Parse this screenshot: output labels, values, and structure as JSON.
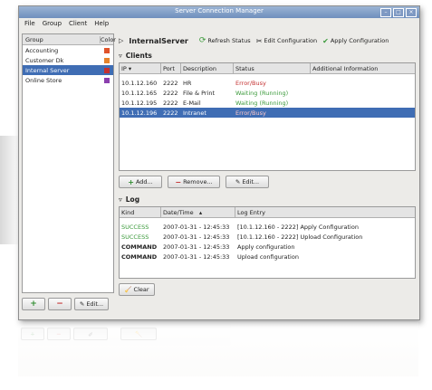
{
  "window": {
    "title": "Server Connection Manager"
  },
  "menu": [
    "File",
    "Group",
    "Client",
    "Help"
  ],
  "groups": {
    "headers": [
      "Group",
      "Color"
    ],
    "items": [
      {
        "name": "Accounting",
        "color": "#e0532a",
        "selected": false
      },
      {
        "name": "Customer Dk",
        "color": "#e6832c",
        "selected": false
      },
      {
        "name": "Internal Server",
        "color": "#c43030",
        "selected": true
      },
      {
        "name": "Online Store",
        "color": "#8b3fae",
        "selected": false
      }
    ],
    "buttons": {
      "add": "+",
      "remove": "−",
      "edit": "Edit..."
    }
  },
  "server": {
    "name": "InternalServer",
    "refresh_label": "Refresh Status",
    "edit_config_label": "Edit Configuration",
    "apply_config_label": "Apply Configuration"
  },
  "clients": {
    "section_label": "Clients",
    "headers": [
      "IP",
      "Port",
      "Description",
      "Status",
      "Additional Information"
    ],
    "rows": [
      {
        "ip": "10.1.12.160",
        "port": "2222",
        "description": "HR",
        "status": "Error/Busy",
        "status_color": "red",
        "info": ""
      },
      {
        "ip": "10.1.12.165",
        "port": "2222",
        "description": "File & Print",
        "status": "Waiting (Running)",
        "status_color": "green",
        "info": ""
      },
      {
        "ip": "10.1.12.195",
        "port": "2222",
        "description": "E-Mail",
        "status": "Waiting (Running)",
        "status_color": "green",
        "info": ""
      },
      {
        "ip": "10.1.12.196",
        "port": "2222",
        "description": "Intranet",
        "status": "Error/Busy",
        "status_color": "red",
        "info": "",
        "selected": true
      }
    ],
    "buttons": {
      "add": "Add...",
      "remove": "Remove...",
      "edit": "Edit..."
    }
  },
  "log": {
    "section_label": "Log",
    "headers": [
      "Kind",
      "Date/Time",
      "Log Entry"
    ],
    "rows": [
      {
        "kind": "SUCCESS",
        "datetime": "2007-01-31 - 12:45:33",
        "entry": "[10.1.12.160 - 2222] Apply Configuration",
        "kind_color": "green"
      },
      {
        "kind": "SUCCESS",
        "datetime": "2007-01-31 - 12:45:33",
        "entry": "[10.1.12.160 - 2222] Upload Configuration",
        "kind_color": "green"
      },
      {
        "kind": "COMMAND",
        "datetime": "2007-01-31 - 12:45:33",
        "entry": "Apply configuration",
        "kind_color": "black"
      },
      {
        "kind": "COMMAND",
        "datetime": "2007-01-31 - 12:45:33",
        "entry": "Upload configuration",
        "kind_color": "black"
      }
    ],
    "clear_label": "Clear"
  }
}
